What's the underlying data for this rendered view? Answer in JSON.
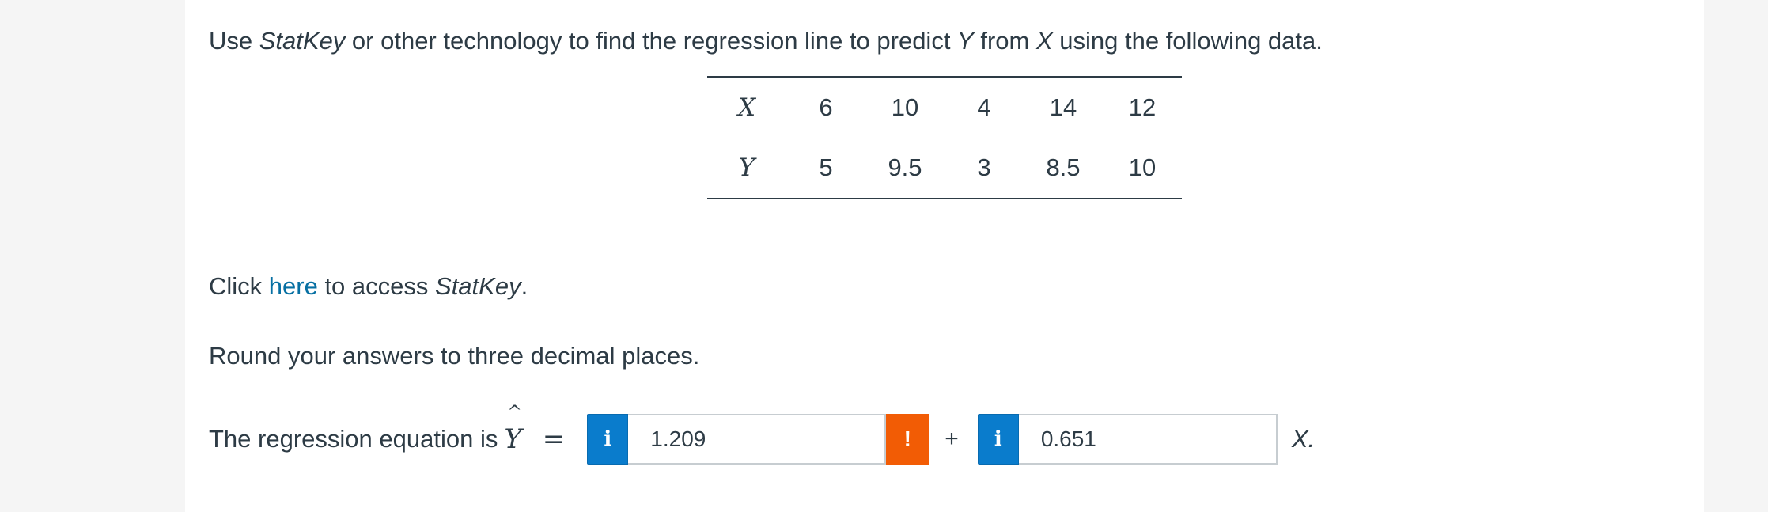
{
  "question": {
    "intro_1": "Use ",
    "intro_statkey": "StatKey",
    "intro_2": " or other technology to find the regression line to predict ",
    "intro_y": "Y",
    "intro_3": " from ",
    "intro_x": "X",
    "intro_4": " using the following data."
  },
  "table": {
    "x_label": "X",
    "x_values": [
      "6",
      "10",
      "4",
      "14",
      "12"
    ],
    "y_label": "Y",
    "y_values": [
      "5",
      "9.5",
      "3",
      "8.5",
      "10"
    ]
  },
  "click_line": {
    "prefix": "Click ",
    "link": "here",
    "middle": " to access ",
    "statkey": "StatKey",
    "suffix": "."
  },
  "round_instruction": "Round your answers to three decimal places.",
  "equation": {
    "label": "The regression equation is ",
    "yhat": "Y",
    "hat": "^",
    "equals": "=",
    "info_icon": "i",
    "intercept_value": "1.209",
    "warning_icon": "!",
    "plus": "+",
    "slope_value": "0.651",
    "x_suffix": "X."
  }
}
